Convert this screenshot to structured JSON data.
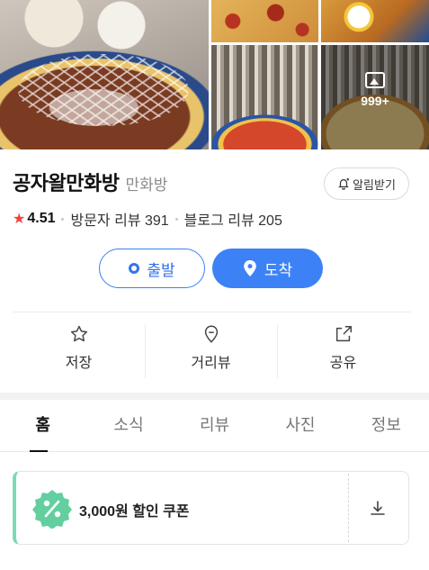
{
  "photos": {
    "more_count": "999+",
    "more_icon": "image-icon"
  },
  "place": {
    "name": "공자왈만화방",
    "category": "만화방",
    "alert_label": "알림받기",
    "alert_icon": "bell-plus-icon"
  },
  "stats": {
    "star_icon": "star-icon",
    "rating": "4.51",
    "visitor_reviews": "방문자 리뷰 391",
    "blog_reviews": "블로그 리뷰 205",
    "accent_star": "#f0443a"
  },
  "route": {
    "depart_label": "출발",
    "arrive_label": "도착",
    "accent": "#3c82f6"
  },
  "actions": {
    "save_label": "저장",
    "distance_label": "거리뷰",
    "share_label": "공유"
  },
  "tabs": [
    {
      "label": "홈",
      "active": true
    },
    {
      "label": "소식",
      "active": false
    },
    {
      "label": "리뷰",
      "active": false
    },
    {
      "label": "사진",
      "active": false
    },
    {
      "label": "정보",
      "active": false
    }
  ],
  "coupon": {
    "label": "3,000원 할인 쿠폰",
    "badge_icon": "percent-badge-icon",
    "download_icon": "download-icon",
    "accent": "#7ed9b4"
  }
}
